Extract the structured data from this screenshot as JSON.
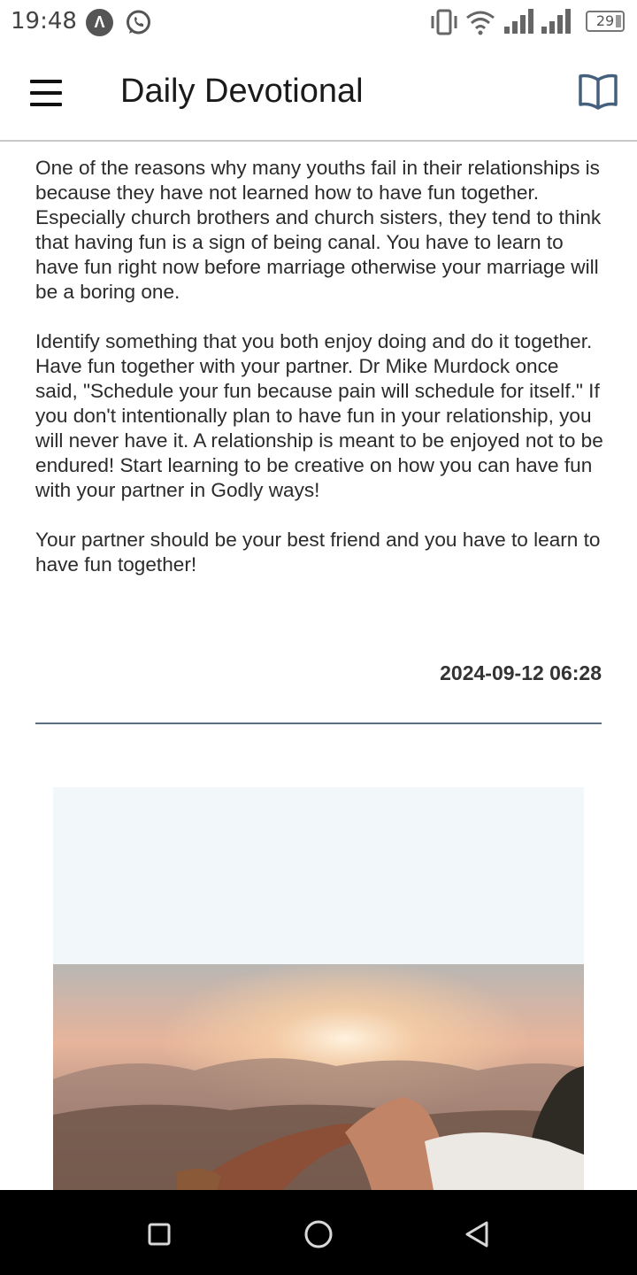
{
  "status_bar": {
    "time": "19:48",
    "battery": "29"
  },
  "app_bar": {
    "title": "Daily Devotional"
  },
  "article": {
    "paragraphs": [
      "One of the reasons why many youths fail in their relationships is because they have not  learned how to have fun together. Especially church brothers and church sisters, they tend to think that having fun is a sign of being canal. You have to learn to have fun right now before marriage otherwise your marriage will be a boring one.",
      "Identify something that you both enjoy doing and do it together. Have fun together with your partner. Dr Mike Murdock once said, \"Schedule your fun because pain will schedule for itself.\" If you don't intentionally plan to have fun in your relationship, you will never have it. A relationship is meant to be enjoyed not to be endured! Start learning to be creative on how you can have fun with your partner in Godly ways!",
      "Your partner should be your best friend and you have to learn to have fun together!"
    ],
    "timestamp": "2024-09-12 06:28"
  },
  "colors": {
    "divider": "#5b6e80",
    "book_icon": "#44607c",
    "image_pad": "#f2f7fa",
    "nav_bar": "#000000"
  },
  "icons": {
    "menu": "hamburger-menu-icon",
    "book": "open-book-icon",
    "nav_recents": "square-icon",
    "nav_home": "circle-icon",
    "nav_back": "triangle-back-icon"
  }
}
